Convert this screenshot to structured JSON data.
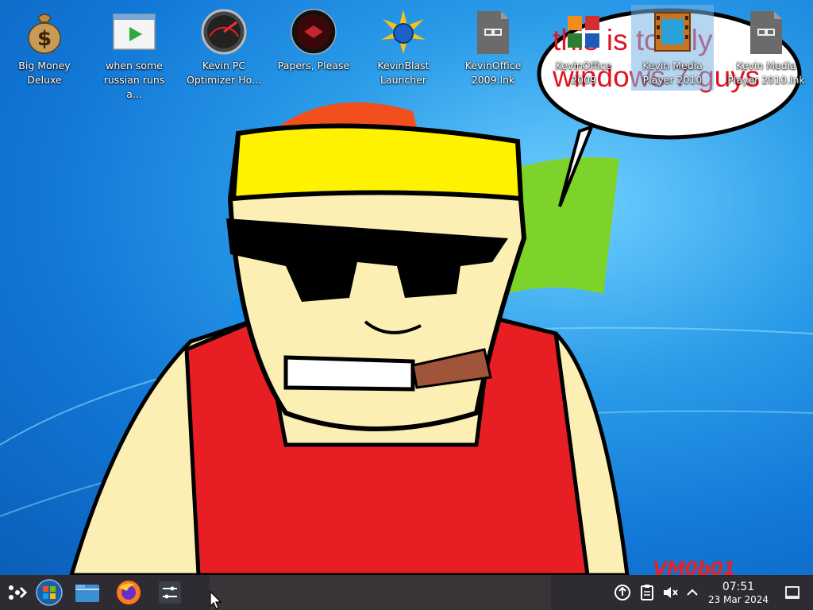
{
  "desktop": {
    "icons": [
      {
        "label": "Big Money Deluxe",
        "icon": "money-bag-icon",
        "selected": false
      },
      {
        "label": "when some russian runs a...",
        "icon": "video-player-window-icon",
        "selected": false
      },
      {
        "label": "Kevin PC Optimizer Ho...",
        "icon": "speedometer-icon",
        "selected": false
      },
      {
        "label": "Papers, Please",
        "icon": "papers-please-seal-icon",
        "selected": false
      },
      {
        "label": "KevinBlast Launcher",
        "icon": "star-burst-disc-icon",
        "selected": false
      },
      {
        "label": "KevinOffice 2009.lnk",
        "icon": "shortcut-file-icon",
        "selected": false
      },
      {
        "label": "KevinOffice 2009",
        "icon": "office-suite-icon",
        "selected": false
      },
      {
        "label": "Kevin Media Player 2010",
        "icon": "film-strip-icon",
        "selected": true
      },
      {
        "label": "Kevin Media Player 2010.lnk",
        "icon": "shortcut-file-icon",
        "selected": false
      }
    ],
    "wallpaper": {
      "speech_bubble_text": "this is totally windows 7 guys",
      "watermark": "VM0b01"
    }
  },
  "taskbar": {
    "launchers": [
      {
        "name": "application-launcher",
        "icon": "launcher-icon"
      },
      {
        "name": "windows-start",
        "icon": "windows-orb-icon"
      },
      {
        "name": "file-manager",
        "icon": "folder-icon"
      },
      {
        "name": "firefox",
        "icon": "firefox-icon"
      },
      {
        "name": "system-settings",
        "icon": "sliders-icon"
      }
    ],
    "tray": [
      {
        "name": "updates",
        "icon": "update-icon"
      },
      {
        "name": "clipboard",
        "icon": "clipboard-icon"
      },
      {
        "name": "volume",
        "icon": "speaker-muted-icon"
      },
      {
        "name": "show-hidden",
        "icon": "chevron-up-icon"
      }
    ],
    "clock": {
      "time": "07:51",
      "date": "23 Mar 2024"
    },
    "show_desktop_icon": "show-desktop-icon"
  },
  "colors": {
    "taskbar": "#2f2b33",
    "selection": "#78b4e6",
    "bubble_text": "#e01424"
  }
}
